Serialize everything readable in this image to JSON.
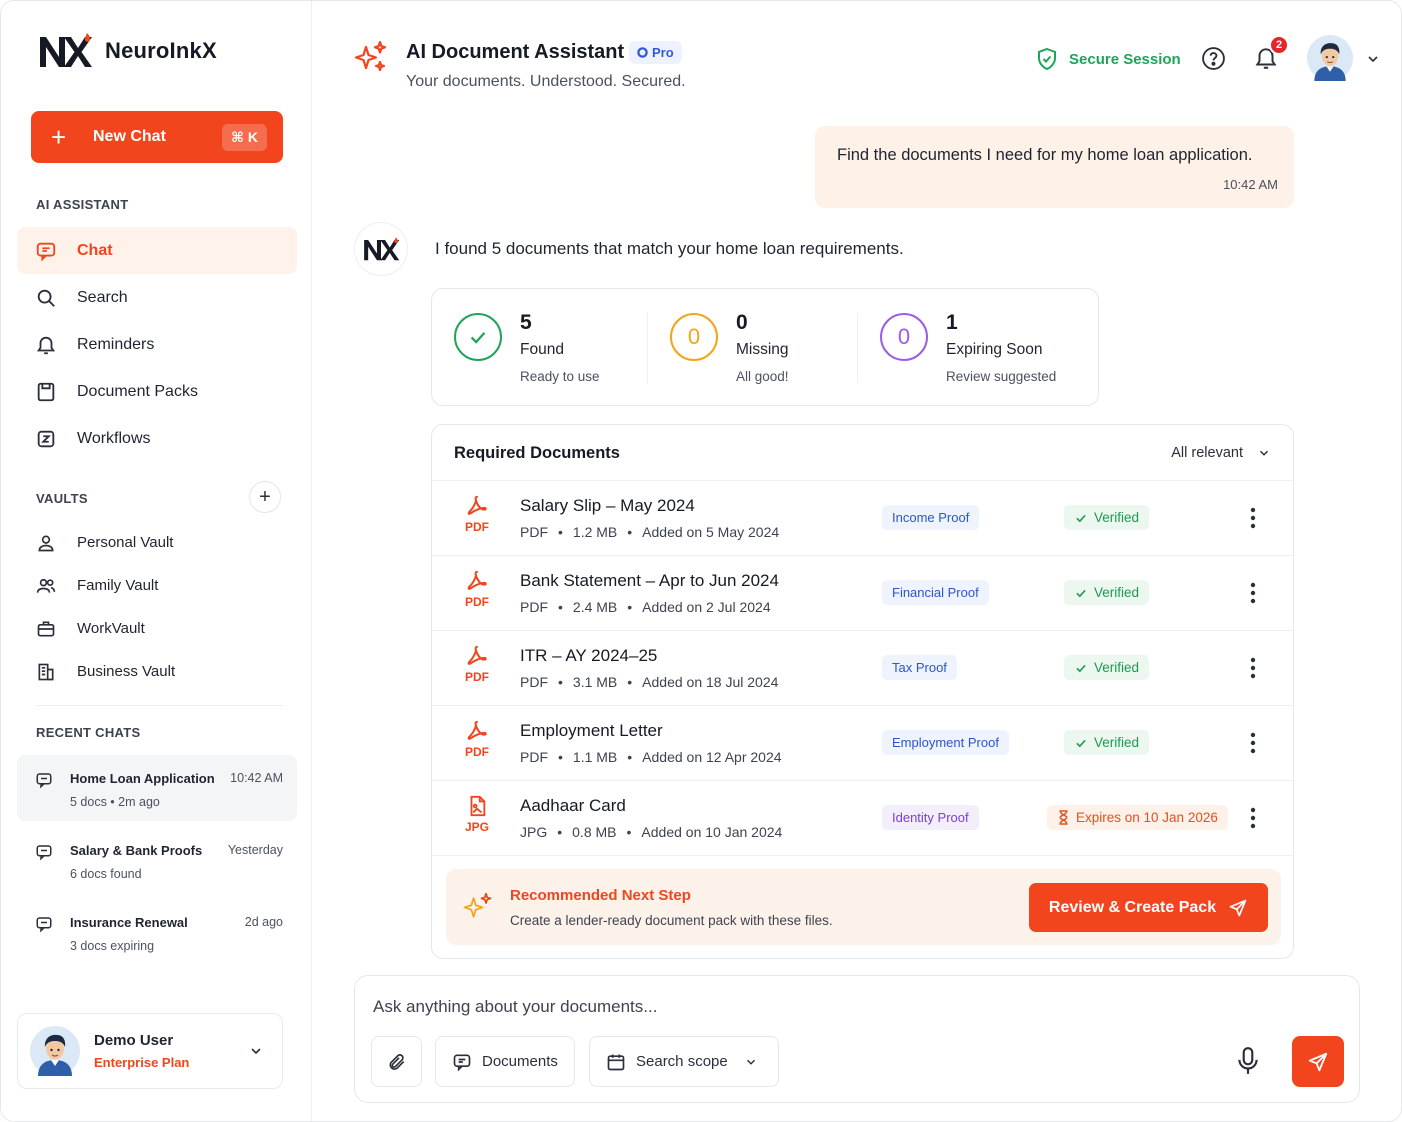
{
  "brand": {
    "name": "NeuroInkX"
  },
  "sidebar": {
    "new_chat": {
      "label": "New Chat",
      "shortcut": "⌘ K"
    },
    "ai_assistant_title": "AI ASSISTANT",
    "nav": [
      {
        "label": "Chat",
        "icon": "chat-icon",
        "active": true
      },
      {
        "label": "Search",
        "icon": "search-icon"
      },
      {
        "label": "Reminders",
        "icon": "bell-icon"
      },
      {
        "label": "Document Packs",
        "icon": "document-pack-icon"
      },
      {
        "label": "Workflows",
        "icon": "workflow-icon"
      }
    ],
    "vaults_title": "VAULTS",
    "vaults": [
      {
        "label": "Personal Vault",
        "icon": "user-icon"
      },
      {
        "label": "Family Vault",
        "icon": "users-icon"
      },
      {
        "label": "WorkVault",
        "icon": "briefcase-icon"
      },
      {
        "label": "Business Vault",
        "icon": "building-icon"
      }
    ],
    "recent_title": "RECENT CHATS",
    "recent": [
      {
        "title": "Home Loan Application",
        "sub": "5 docs • 2m ago",
        "time": "10:42 AM",
        "active": true
      },
      {
        "title": "Salary & Bank Proofs",
        "sub": "6 docs found",
        "time": "Yesterday"
      },
      {
        "title": "Insurance Renewal",
        "sub": "3 docs expiring",
        "time": "2d ago"
      }
    ],
    "user": {
      "name": "Demo User",
      "plan": "Enterprise Plan"
    }
  },
  "header": {
    "title": "AI Document Assistant",
    "badge": "Pro",
    "subtitle": "Your documents. Understood. Secured.",
    "secure": "Secure Session",
    "notifications": "2"
  },
  "chat": {
    "user_message": "Find the documents I need for my home loan application.",
    "user_time": "10:42 AM",
    "bot_message": "I found 5 documents that match your home loan requirements."
  },
  "stats": [
    {
      "value": "5",
      "label": "Found",
      "sub": "Ready to use",
      "color": "#22a35a"
    },
    {
      "value": "0",
      "label": "Missing",
      "sub": "All good!",
      "color": "#f2a516"
    },
    {
      "value": "1",
      "label": "Expiring Soon",
      "sub": "Review suggested",
      "color": "#9b5de5"
    }
  ],
  "required": {
    "title": "Required Documents",
    "filter": "All relevant",
    "documents": [
      {
        "name": "Salary Slip – May 2024",
        "type": "PDF",
        "size": "1.2 MB",
        "added": "Added on 5 May 2024",
        "tag": "Income Proof",
        "status": "Verified"
      },
      {
        "name": "Bank Statement – Apr to Jun 2024",
        "type": "PDF",
        "size": "2.4 MB",
        "added": "Added on 2 Jul 2024",
        "tag": "Financial Proof",
        "status": "Verified"
      },
      {
        "name": "ITR – AY 2024–25",
        "type": "PDF",
        "size": "3.1 MB",
        "added": "Added on 18 Jul 2024",
        "tag": "Tax Proof",
        "status": "Verified"
      },
      {
        "name": "Employment Letter",
        "type": "PDF",
        "size": "1.1 MB",
        "added": "Added on 12 Apr 2024",
        "tag": "Employment Proof",
        "status": "Verified"
      },
      {
        "name": "Aadhaar Card",
        "type": "JPG",
        "size": "0.8 MB",
        "added": "Added on 10 Jan 2024",
        "tag": "Identity Proof",
        "status": "Expires on 10 Jan 2026"
      }
    ],
    "next_step": {
      "title": "Recommended Next Step",
      "sub": "Create a lender-ready document pack with these files.",
      "button": "Review & Create Pack"
    }
  },
  "composer": {
    "placeholder": "Ask anything about your documents...",
    "documents_btn": "Documents",
    "scope_btn": "Search scope"
  },
  "colors": {
    "accent": "#f2451d",
    "success": "#1e9a50",
    "blue": "#2c56c8",
    "purple": "#7b3fd6"
  }
}
